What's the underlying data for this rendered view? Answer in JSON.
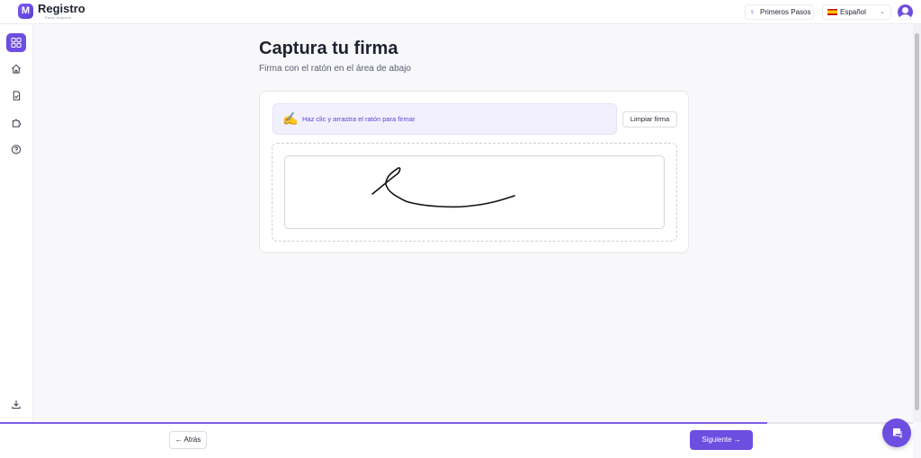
{
  "header": {
    "logo_letter": "M",
    "brand": "Registro",
    "brand_sub": "Parte Viajeros",
    "steps_label": "Primeros Pasos",
    "steps_icon": "lightbulb-icon",
    "language": "Español",
    "language_flag": "spain-flag-icon"
  },
  "sidebar": {
    "items": [
      {
        "icon": "grid-icon",
        "active": true
      },
      {
        "icon": "home-icon",
        "active": false
      },
      {
        "icon": "document-check-icon",
        "active": false
      },
      {
        "icon": "puzzle-icon",
        "active": false
      },
      {
        "icon": "help-icon",
        "active": false
      },
      {
        "icon": "download-icon",
        "active": false
      }
    ]
  },
  "main": {
    "title": "Captura tu firma",
    "subtitle": "Firma con el ratón en el área de abajo",
    "hint": "Haz clic y arrastra el ratón para firmar",
    "clear_label": "Limpiar firma"
  },
  "footer": {
    "back_label": "← Atrás",
    "next_label": "Siguiente →",
    "progress_fraction": 0.84
  },
  "colors": {
    "accent": "#6d4ee0",
    "hint_bg": "#f3f0fe",
    "hint_text": "#5b3fd6"
  }
}
